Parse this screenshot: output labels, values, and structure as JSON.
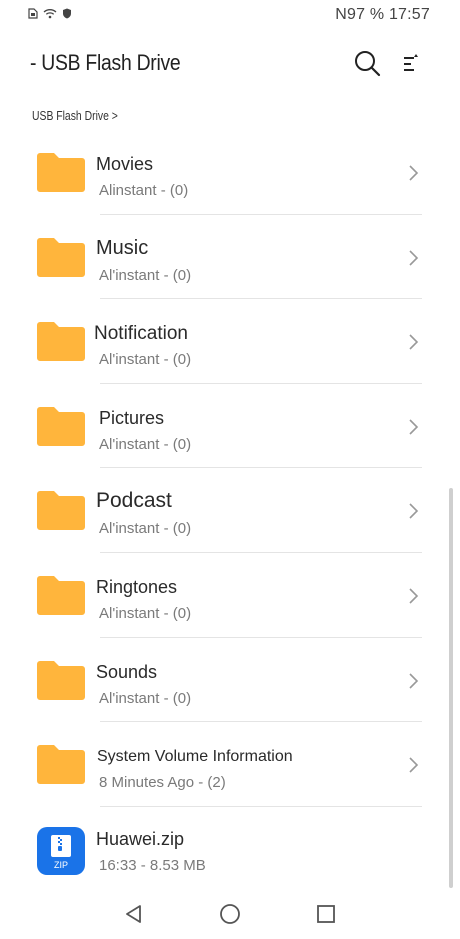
{
  "status": {
    "icons": [
      "sim-icon",
      "wifi-icon",
      "shield-icon"
    ],
    "indicators": "N97 %",
    "time": "17:57"
  },
  "header": {
    "title": "- USB Flash Drive",
    "search_icon": "search-icon",
    "sort_icon": "sort-icon"
  },
  "breadcrumb": "USB Flash Drive >",
  "items": [
    {
      "name": "Movies",
      "meta": "Alinstant - (0)",
      "icon": "folder-icon"
    },
    {
      "name": "Music",
      "meta": "Al'instant - (0)",
      "icon": "folder-icon"
    },
    {
      "name": "Notification",
      "meta": "Al'instant - (0)",
      "icon": "folder-icon"
    },
    {
      "name": "Pictures",
      "meta": "Al'instant - (0)",
      "icon": "folder-icon"
    },
    {
      "name": "Podcast",
      "meta": "Al'instant - (0)",
      "icon": "folder-icon"
    },
    {
      "name": "Ringtones",
      "meta": "Al'instant - (0)",
      "icon": "folder-icon"
    },
    {
      "name": "Sounds",
      "meta": "Al'instant - (0)",
      "icon": "folder-icon"
    },
    {
      "name": "System Volume Information",
      "meta": "8 Minutes Ago - (2)",
      "icon": "folder-icon"
    },
    {
      "name": "Huawei.zip",
      "meta": "16:33 - 8.53 MB",
      "icon": "zip-file-icon",
      "badge": "ZIP"
    }
  ],
  "navigation": {
    "back_icon": "back-triangle-icon",
    "home_icon": "home-circle-icon",
    "recents_icon": "recents-square-icon"
  },
  "colors": {
    "folder": "#FFB53C",
    "zip": "#1A73E8",
    "text": "#2A2A2A",
    "meta": "#7A7A7A"
  }
}
